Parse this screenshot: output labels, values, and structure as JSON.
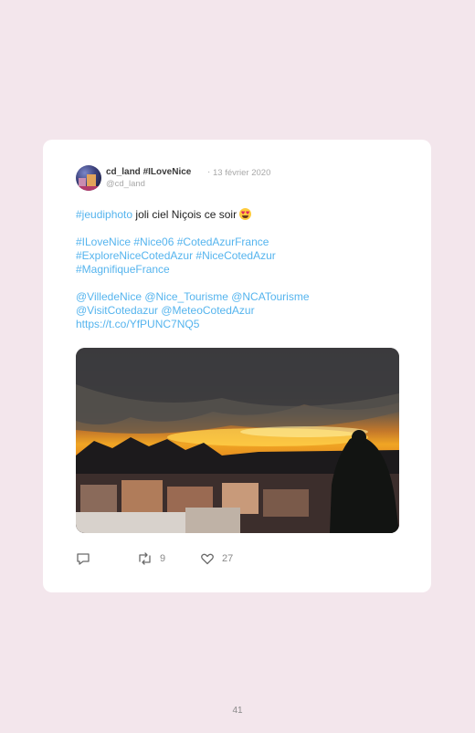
{
  "tweet": {
    "display_name": "cd_land #ILoveNice",
    "separator": "·",
    "date": "13 février 2020",
    "handle": "@cd_land",
    "line1_tag": "#jeudiphoto",
    "line1_text": " joli ciel Niçois ce soir",
    "tags_line1": "#ILoveNice #Nice06 #CotedAzurFrance",
    "tags_line2": "#ExploreNiceCotedAzur #NiceCotedAzur",
    "tags_line3": "#MagnifiqueFrance",
    "mentions_line1": "@VilledeNice @Nice_Tourisme @NCATourisme",
    "mentions_line2": "@VisitCotedazur @MeteoCotedAzur",
    "link": "https://t.co/YfPUNC7NQ5"
  },
  "actions": {
    "reply_icon": "reply-icon",
    "retweet_icon": "retweet-icon",
    "retweet_count": "9",
    "like_icon": "heart-icon",
    "like_count": "27"
  },
  "page": {
    "number": "41"
  },
  "colors": {
    "background": "#f3e6ec",
    "card": "#ffffff",
    "link_blue": "#55b4ee",
    "muted": "#a8a8a8"
  }
}
